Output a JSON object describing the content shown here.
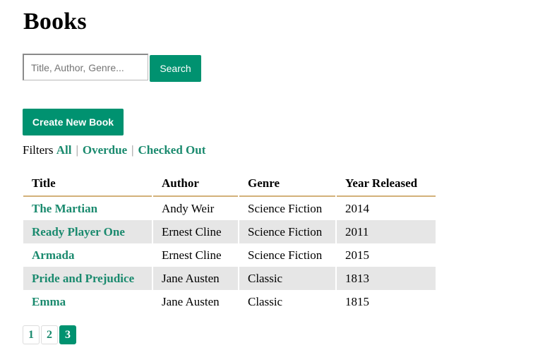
{
  "page_title": "Books",
  "search": {
    "placeholder": "Title, Author, Genre...",
    "value": "",
    "button_label": "Search"
  },
  "create_button_label": "Create New Book",
  "filters": {
    "label": "Filters",
    "items": [
      "All",
      "Overdue",
      "Checked Out"
    ],
    "separator": "|"
  },
  "table": {
    "headers": [
      "Title",
      "Author",
      "Genre",
      "Year Released"
    ],
    "rows": [
      {
        "title": "The Martian",
        "author": "Andy Weir",
        "genre": "Science Fiction",
        "year": "2014"
      },
      {
        "title": "Ready Player One",
        "author": "Ernest Cline",
        "genre": "Science Fiction",
        "year": "2011"
      },
      {
        "title": "Armada",
        "author": "Ernest Cline",
        "genre": "Science Fiction",
        "year": "2015"
      },
      {
        "title": "Pride and Prejudice",
        "author": "Jane Austen",
        "genre": "Classic",
        "year": "1813"
      },
      {
        "title": "Emma",
        "author": "Jane Austen",
        "genre": "Classic",
        "year": "1815"
      }
    ]
  },
  "pagination": {
    "pages": [
      "1",
      "2",
      "3"
    ],
    "current": "3"
  },
  "colors": {
    "accent": "#009270",
    "link": "#1a8a6e",
    "header_rule": "#d3b17a",
    "alt_row": "#e6e6e6"
  }
}
